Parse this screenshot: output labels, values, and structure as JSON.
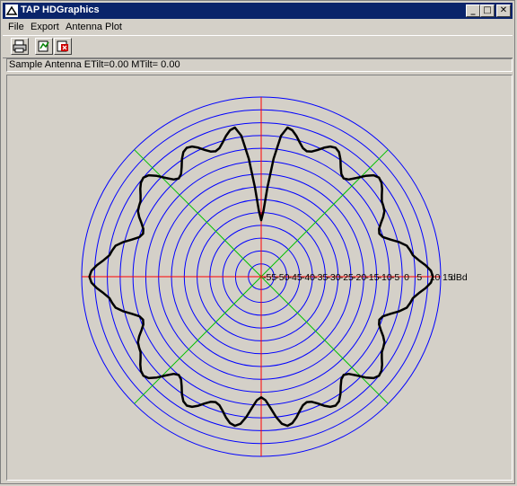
{
  "window": {
    "title": "TAP HDGraphics",
    "controls": {
      "minimize": "_",
      "maximize": "□",
      "close": "✕"
    }
  },
  "menu": {
    "items": [
      "File",
      "Export",
      "Antenna Plot"
    ]
  },
  "toolbar": {
    "buttons": [
      "printer-icon",
      "export-icon",
      "close-document-icon"
    ]
  },
  "status": {
    "text": "Sample Antenna ETilt=0.00 MTilt= 0.00"
  },
  "colors": {
    "rings": "#0000ff",
    "axes": "#ff0000",
    "diagonals": "#00c000",
    "pattern": "#000000",
    "titlebar": "#0a246a"
  },
  "chart_data": {
    "type": "polar",
    "unit": "dBd",
    "radial_ticks": [
      "-55",
      "-50",
      "-45",
      "-40",
      "-35",
      "-30",
      "-25",
      "-20",
      "-15",
      "-10",
      "-5",
      "0",
      "5",
      "10",
      "15"
    ],
    "radial_range": [
      -55,
      15
    ],
    "pattern": {
      "angles_deg": [
        0,
        10,
        20,
        30,
        40,
        50,
        60,
        70,
        80,
        90,
        100,
        110,
        120,
        130,
        140,
        150,
        160,
        170,
        180,
        190,
        200,
        210,
        220,
        230,
        240,
        250,
        260,
        270,
        280,
        290,
        300,
        310,
        320,
        330,
        340,
        350
      ],
      "gain_dbd": [
        12,
        4,
        -6,
        0,
        5,
        -5,
        3,
        -3,
        4,
        -33,
        4,
        -3,
        3,
        -5,
        5,
        0,
        -6,
        4,
        12,
        4,
        -6,
        0,
        5,
        -5,
        3,
        -3,
        4,
        -8,
        4,
        -3,
        3,
        -5,
        5,
        0,
        -6,
        4
      ]
    }
  }
}
